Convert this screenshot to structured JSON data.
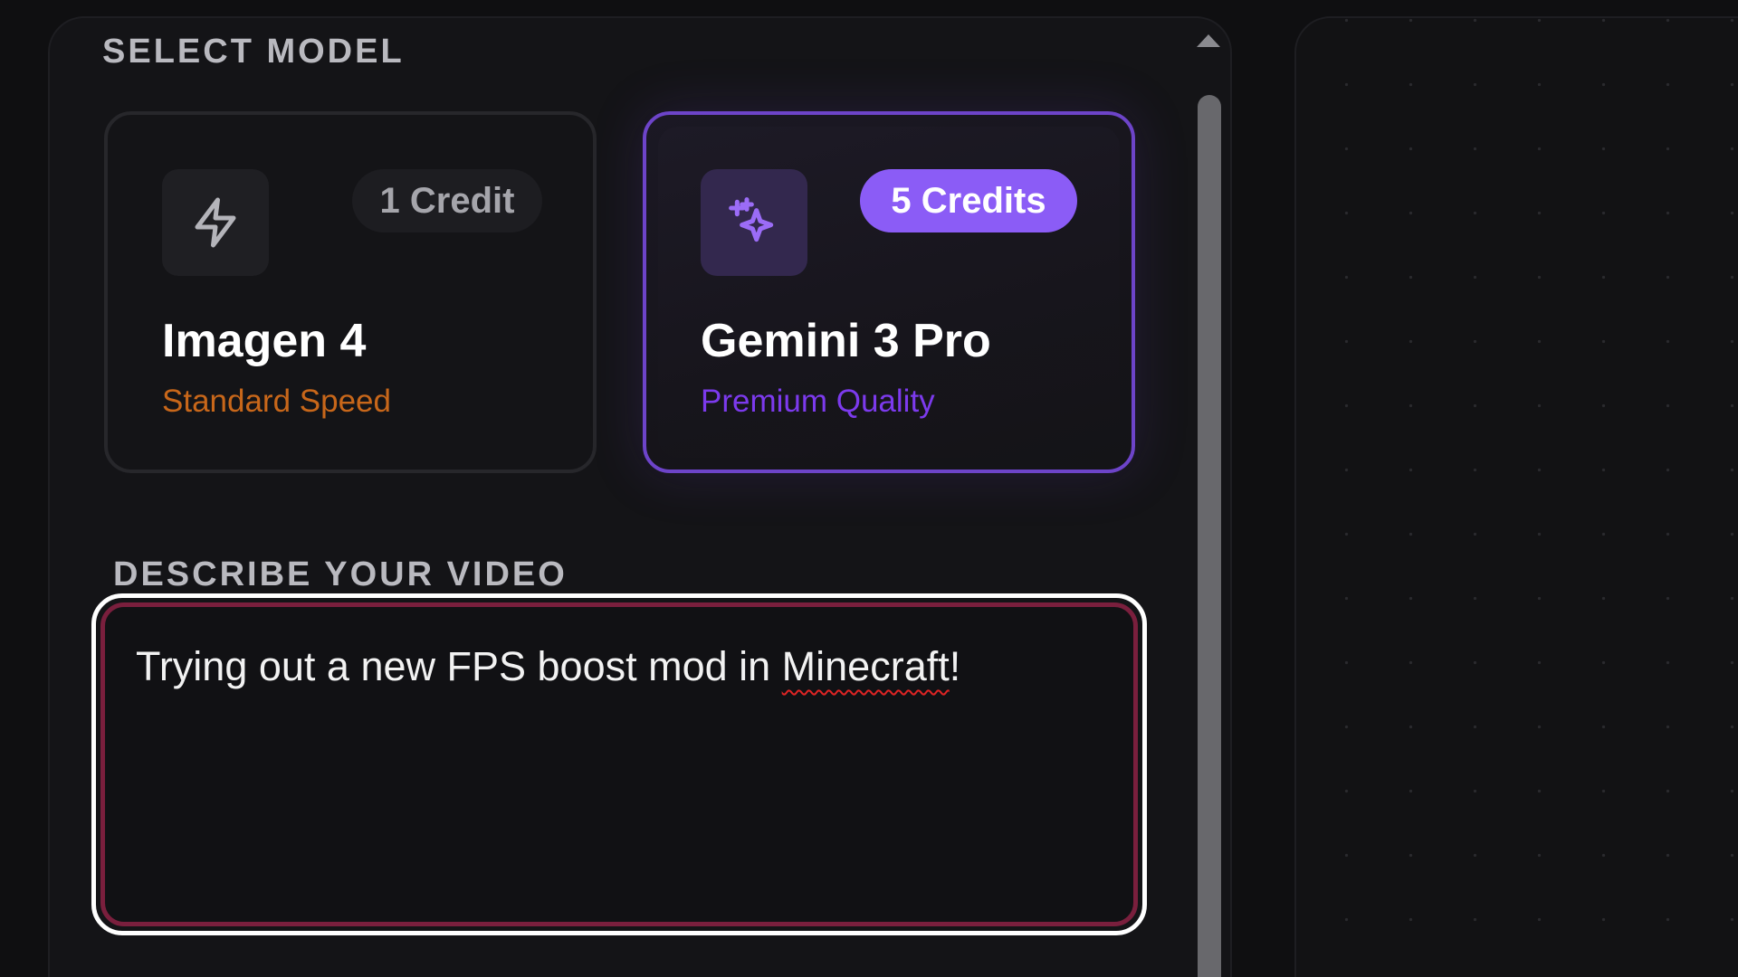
{
  "select_model": {
    "label": "SELECT MODEL",
    "models": [
      {
        "name": "Imagen 4",
        "subtitle": "Standard Speed",
        "credits": "1 Credit",
        "icon": "lightning-bolt-icon",
        "selected": false,
        "subtitle_color": "#c8671a"
      },
      {
        "name": "Gemini 3 Pro",
        "subtitle": "Premium Quality",
        "credits": "5 Credits",
        "icon": "sparkle-icon",
        "selected": true,
        "subtitle_color": "#7c3aed",
        "accent_color": "#8b5cf6"
      }
    ]
  },
  "describe": {
    "label": "DESCRIBE YOUR VIDEO",
    "text_before": "Trying out a new FPS boost mod in ",
    "misspelled_word": "Minecraft",
    "text_after": "!",
    "focus_border_color": "#ffffff",
    "inner_border_color": "#7a1f3d"
  }
}
